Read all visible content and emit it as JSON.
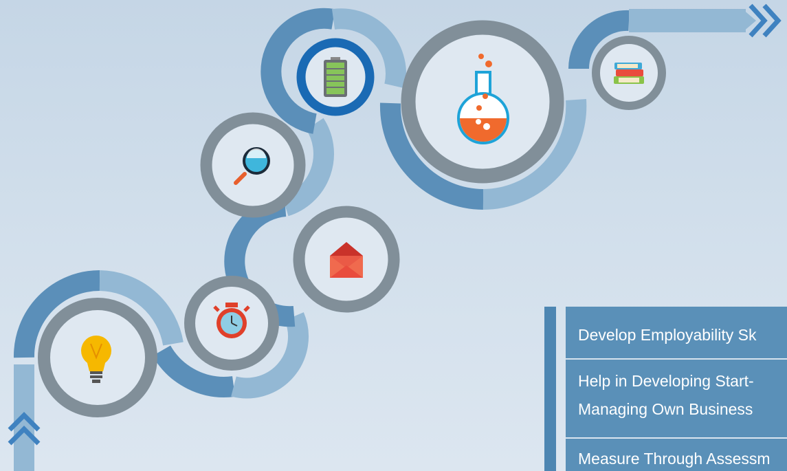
{
  "colors": {
    "dark_segment": "#5b8fb9",
    "light_segment": "#93b8d4",
    "ring": "#818f99",
    "highlight_ring": "#1a6ab4",
    "panel_bar": "#4d86b2",
    "panel_row": "#5a90b8"
  },
  "icons": [
    "lightbulb-icon",
    "stopwatch-icon",
    "envelope-icon",
    "magnifier-icon",
    "battery-icon",
    "flask-icon",
    "books-icon"
  ],
  "panel": {
    "items": [
      {
        "lines": [
          "Develop Employability Sk"
        ]
      },
      {
        "lines": [
          "Help in Developing Start-",
          "Managing Own Business"
        ]
      },
      {
        "lines": [
          "Measure Through Assessm"
        ]
      }
    ]
  }
}
